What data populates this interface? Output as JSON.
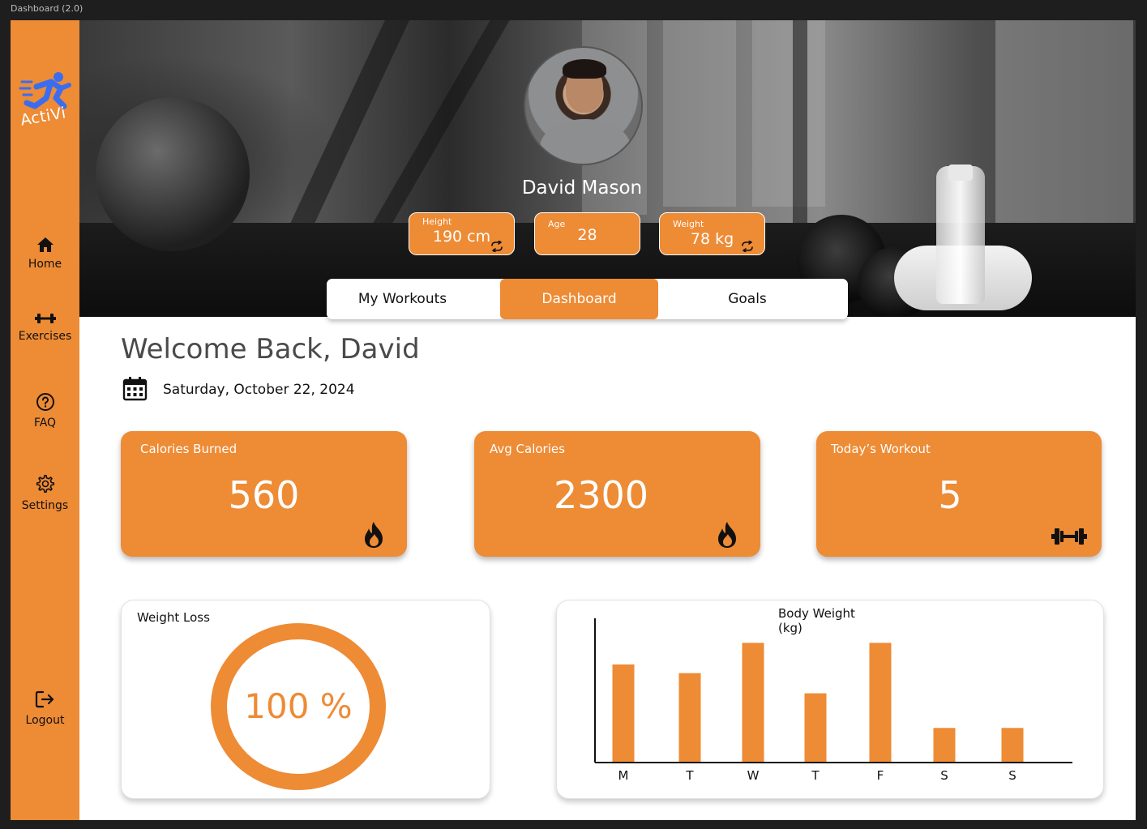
{
  "window": {
    "title": "Dashboard (2.0)"
  },
  "brand": {
    "name": "ActiVi"
  },
  "sidebar": {
    "items": [
      {
        "label": "Home",
        "icon": "home-icon"
      },
      {
        "label": "Exercises",
        "icon": "dumbbell-icon"
      },
      {
        "label": "FAQ",
        "icon": "question-icon"
      },
      {
        "label": "Settings",
        "icon": "gear-icon"
      },
      {
        "label": "Logout",
        "icon": "logout-icon"
      }
    ]
  },
  "profile": {
    "name": "David Mason",
    "stats": [
      {
        "label": "Height",
        "value": "190 cm"
      },
      {
        "label": "Age",
        "value": "28"
      },
      {
        "label": "Weight",
        "value": "78 kg"
      }
    ]
  },
  "tabs": [
    {
      "label": "My Workouts",
      "active": false
    },
    {
      "label": "Dashboard",
      "active": true
    },
    {
      "label": "Goals",
      "active": false
    }
  ],
  "main": {
    "welcome": "Welcome Back, David",
    "date": "Saturday, October 22, 2024"
  },
  "cards": [
    {
      "title": "Calories Burned",
      "value": "560",
      "icon": "flame-icon"
    },
    {
      "title": "Avg Calories",
      "value": "2300",
      "icon": "flame-icon"
    },
    {
      "title": "Today’s Workout",
      "value": "5",
      "icon": "dumbbell-icon"
    }
  ],
  "weight_loss": {
    "title": "Weight Loss",
    "value": "100 %"
  },
  "colors": {
    "accent": "#ee8b35",
    "sidebar": "#ee8b35",
    "text": "#111111"
  },
  "chart_data": {
    "type": "bar",
    "title": "Body Weight\n(kg)",
    "categories": [
      "M",
      "T",
      "W",
      "T",
      "F",
      "S",
      "S"
    ],
    "values": [
      68,
      62,
      83,
      48,
      83,
      24,
      24
    ],
    "ylim": [
      0,
      100
    ],
    "xlabel": "",
    "ylabel": "",
    "grid": false
  }
}
